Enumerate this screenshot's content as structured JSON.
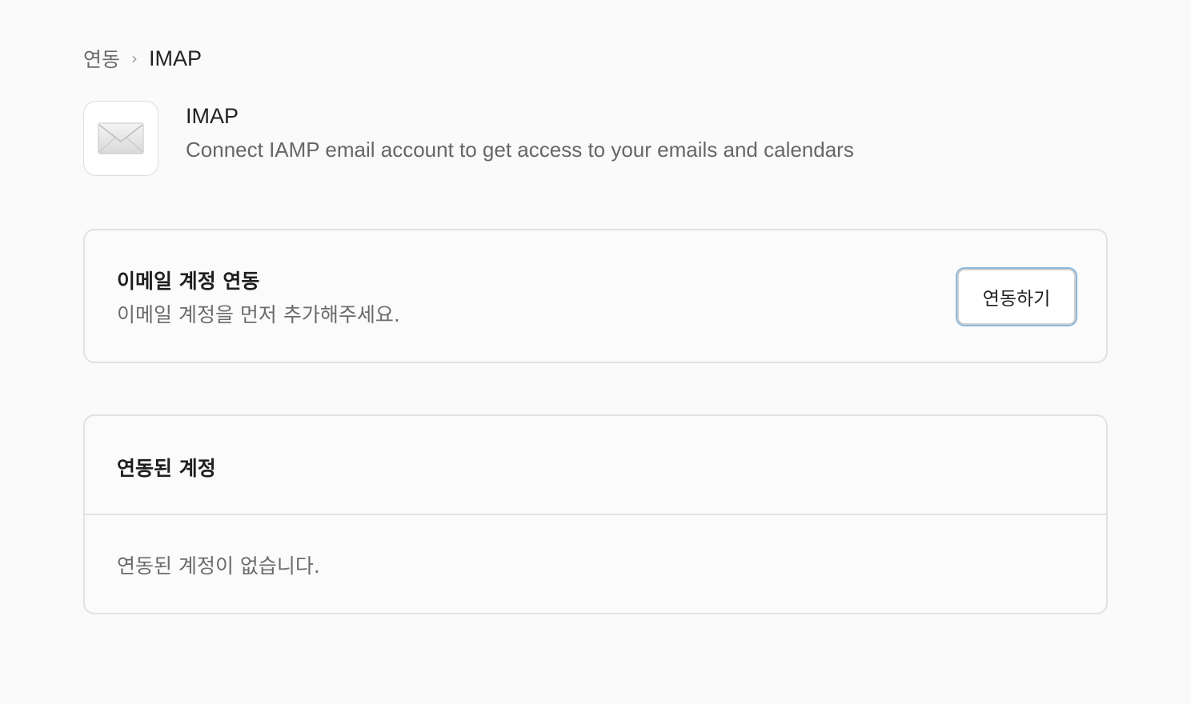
{
  "breadcrumb": {
    "parent": "연동",
    "separator": "›",
    "current": "IMAP"
  },
  "app": {
    "icon": "envelope-icon",
    "title": "IMAP",
    "description": "Connect IAMP email account to get access to your emails and calendars"
  },
  "connect_card": {
    "title": "이메일 계정 연동",
    "description": "이메일 계정을 먼저 추가해주세요.",
    "button_label": "연동하기"
  },
  "accounts_card": {
    "title": "연동된 계정",
    "empty_message": "연동된 계정이 없습니다."
  },
  "colors": {
    "background": "#fafafa",
    "border": "#e2e2e2",
    "focus_ring": "#8ab8de",
    "muted_text": "#6b6b6b"
  }
}
